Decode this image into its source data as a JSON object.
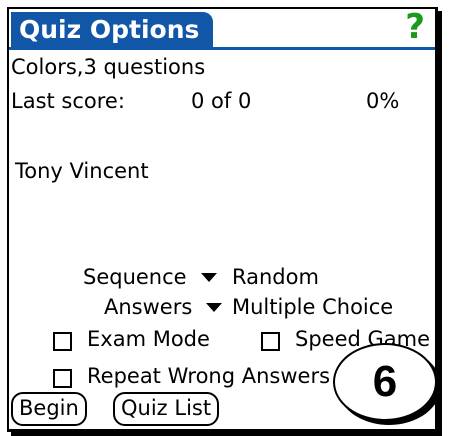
{
  "header": {
    "title": "Quiz Options",
    "help_glyph": "?"
  },
  "quiz": {
    "name_line": "Colors,3 questions"
  },
  "last_score": {
    "label": "Last score:",
    "score": "0 of 0",
    "percent": "0%"
  },
  "user": {
    "name": "Tony Vincent"
  },
  "options": {
    "sequence_label": "Sequence",
    "sequence_value": "Random",
    "answers_label": "Answers",
    "answers_value": "Multiple Choice"
  },
  "checkboxes": {
    "exam_mode": {
      "label": "Exam Mode",
      "checked": false
    },
    "speed_game": {
      "label": "Speed Game",
      "checked": false
    },
    "repeat_wrong": {
      "label": "Repeat Wrong Answers",
      "checked": false
    }
  },
  "buttons": {
    "begin": "Begin",
    "quiz_list": "Quiz List"
  },
  "badge": {
    "number": "6"
  },
  "colors": {
    "title_bar": "#1256a8",
    "help_icon": "#1a9a1a"
  }
}
